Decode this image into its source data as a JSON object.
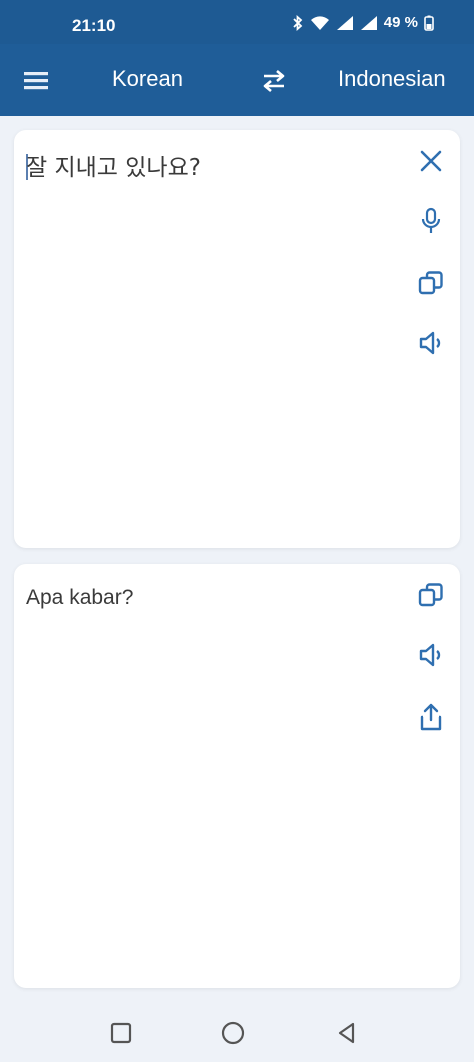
{
  "status": {
    "time": "21:10",
    "battery": "49 %"
  },
  "toolbar": {
    "source_language": "Korean",
    "target_language": "Indonesian"
  },
  "source": {
    "text": "잘 지내고 있나요?"
  },
  "target": {
    "text": "Apa kabar?"
  },
  "icons": {
    "menu": "hamburger-menu-icon",
    "swap": "swap-arrows-icon",
    "clear": "close-icon",
    "mic": "microphone-icon",
    "copy": "copy-icon",
    "speak": "speaker-icon",
    "share": "share-icon"
  },
  "colors": {
    "appbar": "#1f5d98",
    "accent": "#2f6fb0",
    "background": "#eef2f8"
  }
}
